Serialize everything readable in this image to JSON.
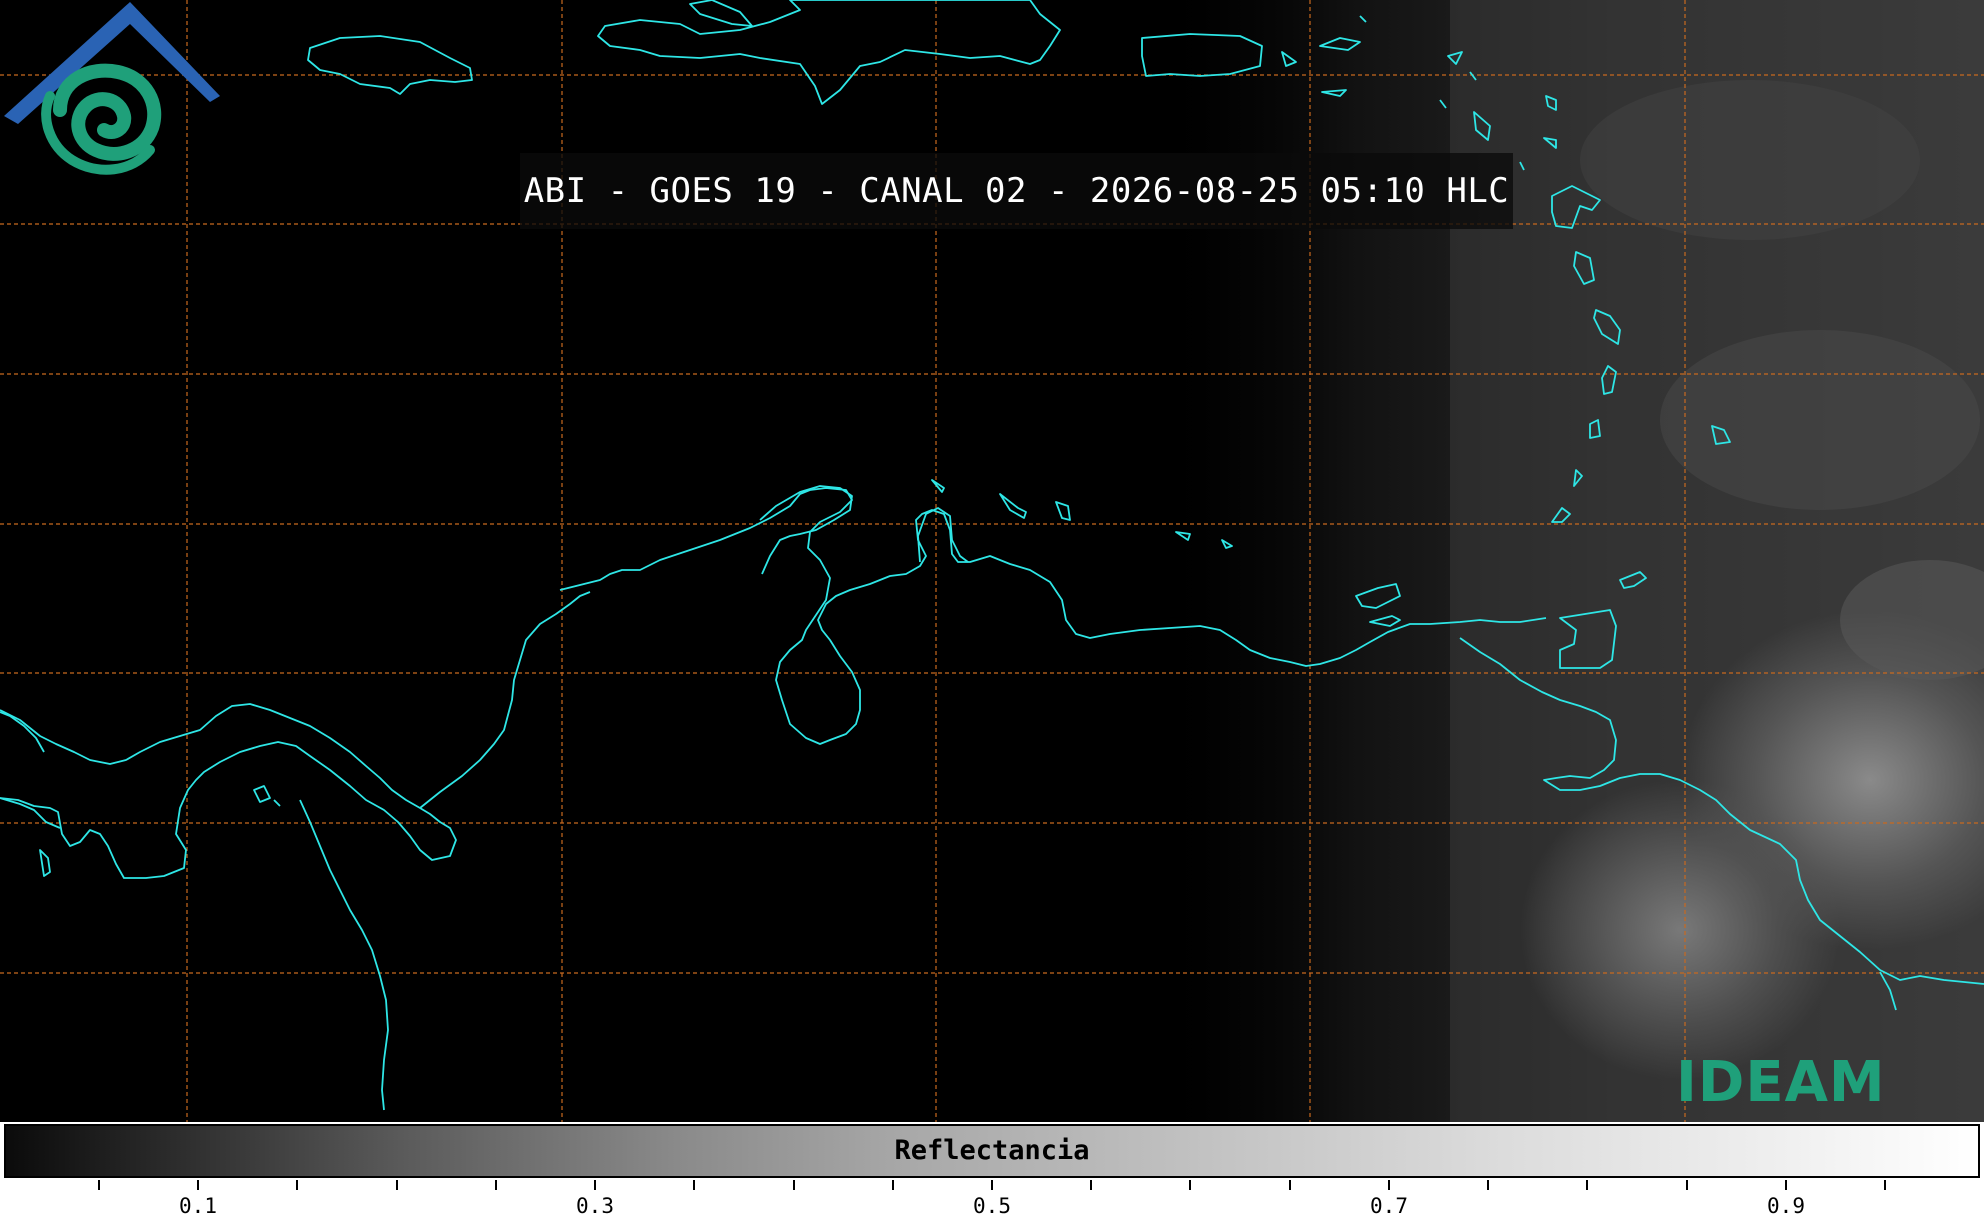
{
  "map": {
    "title": "ABI - GOES 19 - CANAL 02 - 2026-08-25 05:10 HLC",
    "imagery": "satellite visible channel, night side dark, cloud reflectance on east",
    "coastline_color": "#2ee6e6",
    "gridline_color": "#c8691f"
  },
  "logo": {
    "text": "IDEAM",
    "icon": "ideam-logo-icon",
    "colors": {
      "roof": "#2a63b4",
      "swirl": "#1fa07a"
    }
  },
  "colorbar": {
    "label": "Reflectancia",
    "ticks": [
      "0.1",
      "0.3",
      "0.5",
      "0.7",
      "0.9"
    ]
  }
}
